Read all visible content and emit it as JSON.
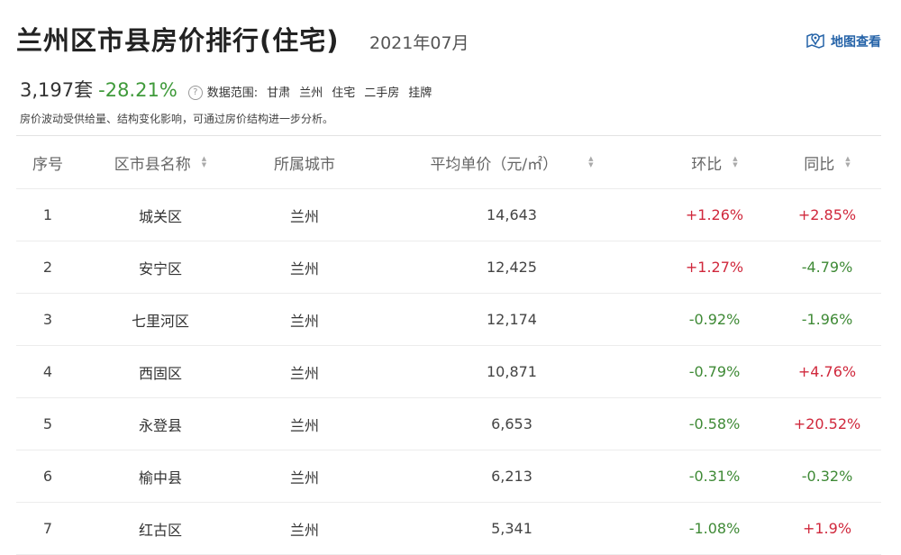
{
  "header": {
    "title": "兰州区市县房价排行(住宅)",
    "date": "2021年07月",
    "map_link": "地图查看"
  },
  "summary": {
    "count": "3,197套",
    "change": "-28.21%",
    "help_icon": "?",
    "scope_label": "数据范围:",
    "scope": [
      "甘肃",
      "兰州",
      "住宅",
      "二手房",
      "挂牌"
    ]
  },
  "note": "房价波动受供给量、结构变化影响，可通过房价结构进一步分析。",
  "table": {
    "columns": [
      "序号",
      "区市县名称",
      "所属城市",
      "平均单价（元/㎡）",
      "环比",
      "同比"
    ],
    "rows": [
      {
        "rank": "1",
        "district": "城关区",
        "city": "兰州",
        "price": "14,643",
        "mom": "+1.26%",
        "yoy": "+2.85%"
      },
      {
        "rank": "2",
        "district": "安宁区",
        "city": "兰州",
        "price": "12,425",
        "mom": "+1.27%",
        "yoy": "-4.79%"
      },
      {
        "rank": "3",
        "district": "七里河区",
        "city": "兰州",
        "price": "12,174",
        "mom": "-0.92%",
        "yoy": "-1.96%"
      },
      {
        "rank": "4",
        "district": "西固区",
        "city": "兰州",
        "price": "10,871",
        "mom": "-0.79%",
        "yoy": "+4.76%"
      },
      {
        "rank": "5",
        "district": "永登县",
        "city": "兰州",
        "price": "6,653",
        "mom": "-0.58%",
        "yoy": "+20.52%"
      },
      {
        "rank": "6",
        "district": "榆中县",
        "city": "兰州",
        "price": "6,213",
        "mom": "-0.31%",
        "yoy": "-0.32%"
      },
      {
        "rank": "7",
        "district": "红古区",
        "city": "兰州",
        "price": "5,341",
        "mom": "-1.08%",
        "yoy": "+1.9%"
      }
    ]
  },
  "colors": {
    "up": "#d0283c",
    "down": "#3f8a36",
    "link": "#2563a8"
  }
}
